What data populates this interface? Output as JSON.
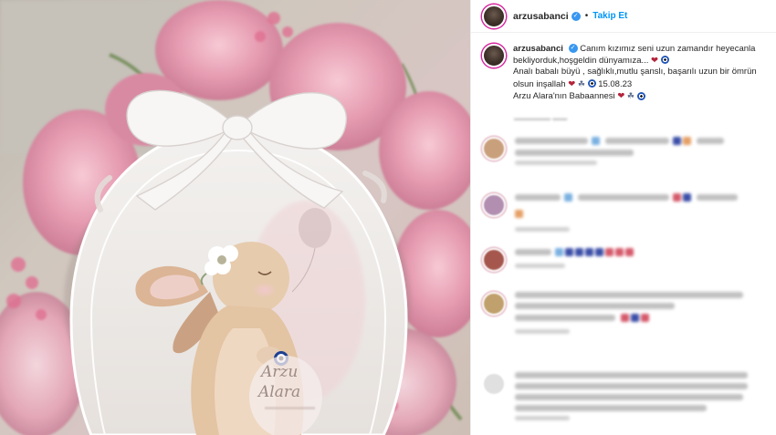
{
  "post": {
    "username": "arzusabanci",
    "follow_label": "Takip Et",
    "separator": "•",
    "caption": {
      "line1": "Canım kızımız seni uzun zamandır heyecanla",
      "line2": "bekliyorduk,hoşgeldin dünyamıza...",
      "line3": "Analı babalı büyü , sağlıklı,mutlu şanslı, başarılı uzun bir ömrün",
      "line4": "olsun inşallah",
      "date": "15.08.23",
      "line5": "Arzu Alara'nın Babaannesi"
    }
  },
  "card": {
    "name_line1": "Arzu",
    "name_line2": "Alara"
  },
  "icons": {
    "verified": "verified-badge-icon",
    "heart": "red-heart-emoji",
    "evil_eye": "nazar-bead-emoji",
    "amulet": "hamsa-emoji"
  },
  "colors": {
    "link_blue": "#0095f6",
    "verified_blue": "#3897f0",
    "story_ring": "#d6249f",
    "heart_red": "#b3243a"
  }
}
